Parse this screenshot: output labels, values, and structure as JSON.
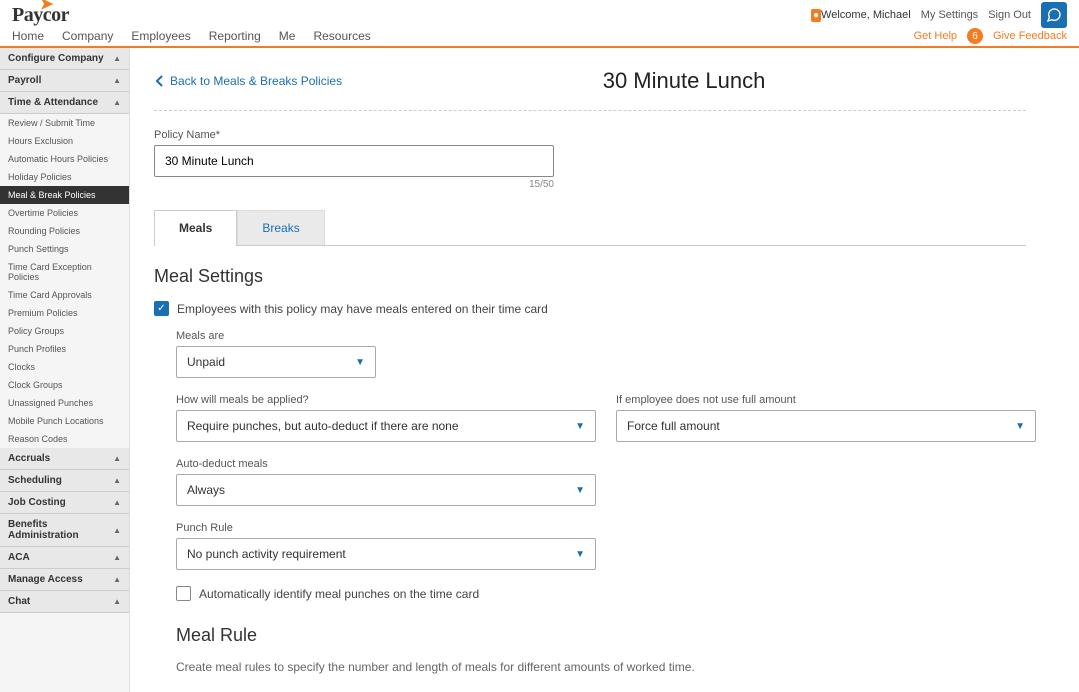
{
  "header": {
    "logo": "Paycor",
    "welcome_prefix": "Welcome,",
    "welcome_name": "Michael",
    "my_settings": "My Settings",
    "sign_out": "Sign Out"
  },
  "nav": {
    "items": [
      "Home",
      "Company",
      "Employees",
      "Reporting",
      "Me",
      "Resources"
    ],
    "get_help": "Get Help",
    "help_count": "6",
    "give_feedback": "Give Feedback"
  },
  "sidebar": {
    "sections": [
      {
        "label": "Configure Company",
        "expanded": false
      },
      {
        "label": "Payroll",
        "expanded": false
      },
      {
        "label": "Time & Attendance",
        "expanded": true,
        "items": [
          "Review / Submit Time",
          "Hours Exclusion",
          "Automatic Hours Policies",
          "Holiday Policies",
          "Meal & Break Policies",
          "Overtime Policies",
          "Rounding Policies",
          "Punch Settings",
          "Time Card Exception Policies",
          "Time Card Approvals",
          "Premium Policies",
          "Policy Groups",
          "Punch Profiles",
          "Clocks",
          "Clock Groups",
          "Unassigned Punches",
          "Mobile Punch Locations",
          "Reason Codes"
        ],
        "active_index": 4
      },
      {
        "label": "Accruals",
        "expanded": false
      },
      {
        "label": "Scheduling",
        "expanded": false
      },
      {
        "label": "Job Costing",
        "expanded": false
      },
      {
        "label": "Benefits Administration",
        "expanded": false
      },
      {
        "label": "ACA",
        "expanded": false
      },
      {
        "label": "Manage Access",
        "expanded": false
      },
      {
        "label": "Chat",
        "expanded": false
      }
    ]
  },
  "page": {
    "back_link": "Back to Meals & Breaks Policies",
    "title": "30 Minute Lunch",
    "policy_name_label": "Policy Name*",
    "policy_name_value": "30 Minute Lunch",
    "char_count": "15/50",
    "tabs": [
      "Meals",
      "Breaks"
    ],
    "active_tab": 0,
    "section_heading": "Meal Settings",
    "checkbox_meals_enabled": "Employees with this policy may have meals entered on their time card",
    "meals_are_label": "Meals are",
    "meals_are_value": "Unpaid",
    "how_applied_label": "How will meals be applied?",
    "how_applied_value": "Require punches, but auto-deduct if there are none",
    "if_not_full_label": "If employee does not use full amount",
    "if_not_full_value": "Force full amount",
    "auto_deduct_label": "Auto-deduct meals",
    "auto_deduct_value": "Always",
    "punch_rule_label": "Punch Rule",
    "punch_rule_value": "No punch activity requirement",
    "auto_identify_label": "Automatically identify meal punches on the time card",
    "meal_rule_heading": "Meal Rule",
    "meal_rule_help": "Create meal rules to specify the number and length of meals for different amounts of worked time."
  }
}
